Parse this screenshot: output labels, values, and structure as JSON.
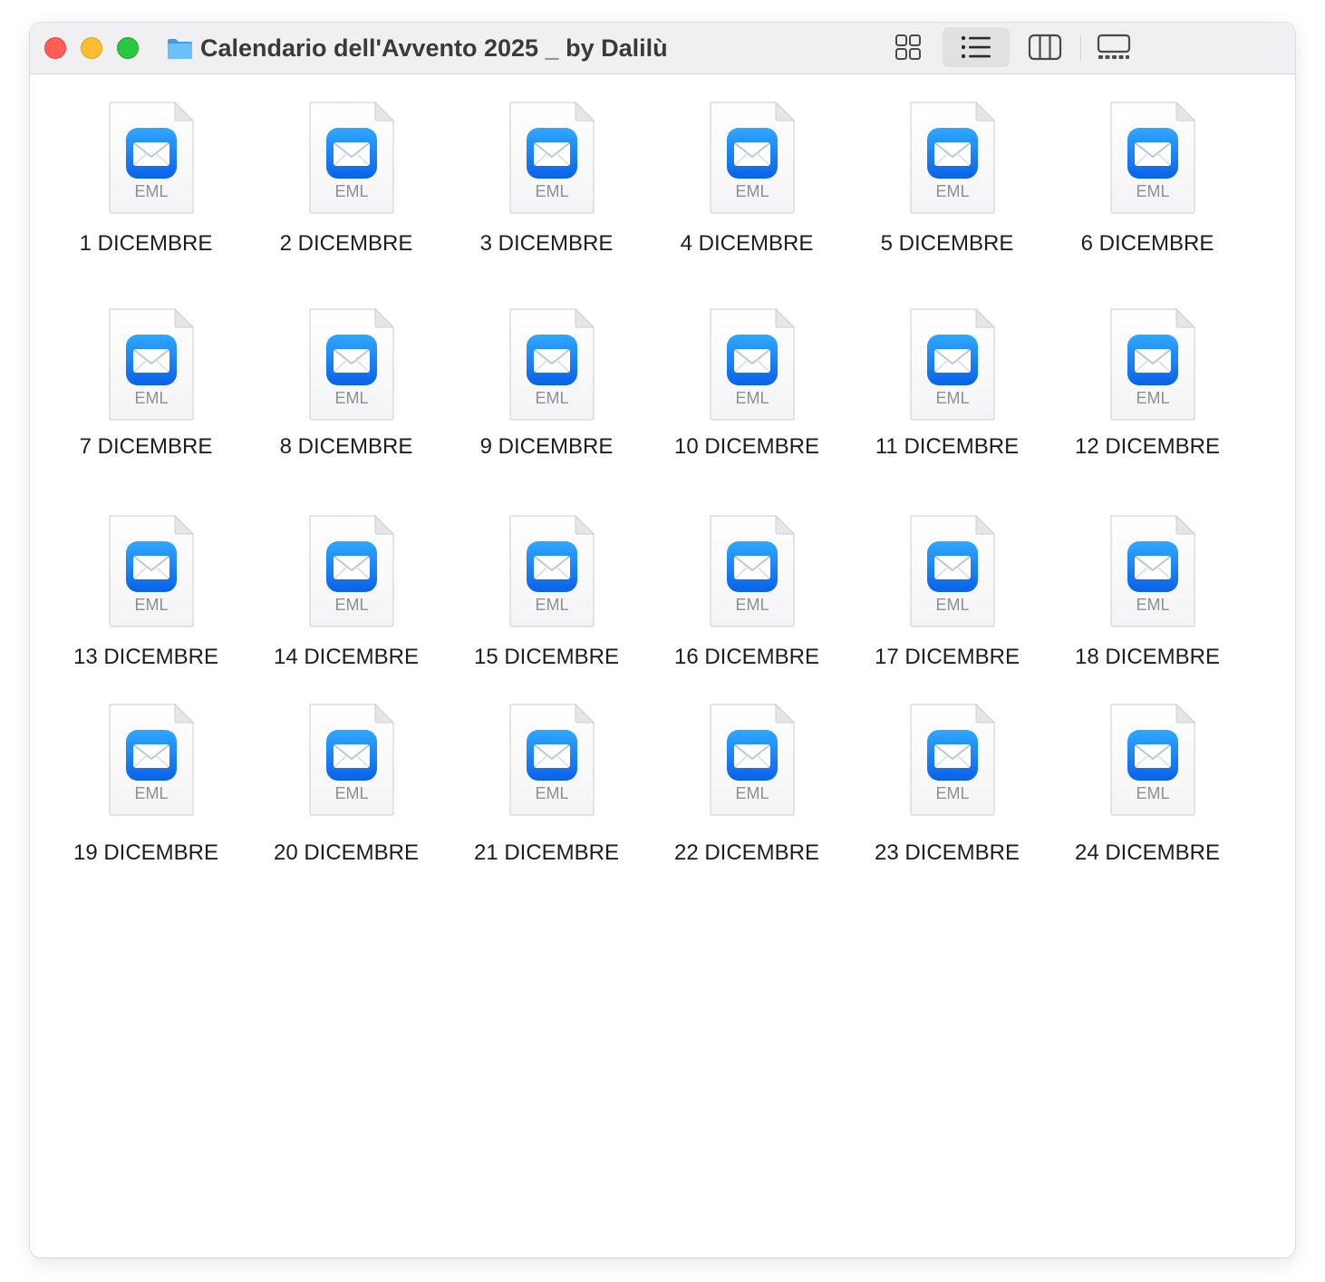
{
  "window": {
    "title": "Calendario dell'Avvento 2025 _ by Dalilù",
    "folder_icon": "folder-icon",
    "controls": [
      "close",
      "minimize",
      "zoom"
    ],
    "view_modes": [
      {
        "name": "icon-view",
        "icon": "grid-icon",
        "active": false
      },
      {
        "name": "list-view",
        "icon": "list-icon",
        "active": true
      },
      {
        "name": "column-view",
        "icon": "columns-icon",
        "active": false
      },
      {
        "name": "gallery-view",
        "icon": "gallery-icon",
        "active": false
      }
    ]
  },
  "file_type_label": "EML",
  "file_icon": "mail-envelope-icon",
  "files": [
    {
      "name": "1 DICEMBRE"
    },
    {
      "name": "2 DICEMBRE"
    },
    {
      "name": "3 DICEMBRE"
    },
    {
      "name": "4 DICEMBRE"
    },
    {
      "name": "5 DICEMBRE"
    },
    {
      "name": "6 DICEMBRE"
    },
    {
      "name": "7 DICEMBRE"
    },
    {
      "name": "8 DICEMBRE"
    },
    {
      "name": "9 DICEMBRE"
    },
    {
      "name": "10 DICEMBRE"
    },
    {
      "name": "11 DICEMBRE"
    },
    {
      "name": "12 DICEMBRE"
    },
    {
      "name": "13 DICEMBRE"
    },
    {
      "name": "14 DICEMBRE"
    },
    {
      "name": "15 DICEMBRE"
    },
    {
      "name": "16 DICEMBRE"
    },
    {
      "name": "17 DICEMBRE"
    },
    {
      "name": "18 DICEMBRE"
    },
    {
      "name": "19 DICEMBRE"
    },
    {
      "name": "20 DICEMBRE"
    },
    {
      "name": "21 DICEMBRE"
    },
    {
      "name": "22 DICEMBRE"
    },
    {
      "name": "23 DICEMBRE"
    },
    {
      "name": "24 DICEMBRE"
    }
  ],
  "colors": {
    "close": "#ff5f57",
    "minimize": "#febc2e",
    "zoom": "#28c840",
    "folder": "#5fb4f5",
    "mail_gradient_top": "#2fa8ff",
    "mail_gradient_bottom": "#0a62e8"
  }
}
